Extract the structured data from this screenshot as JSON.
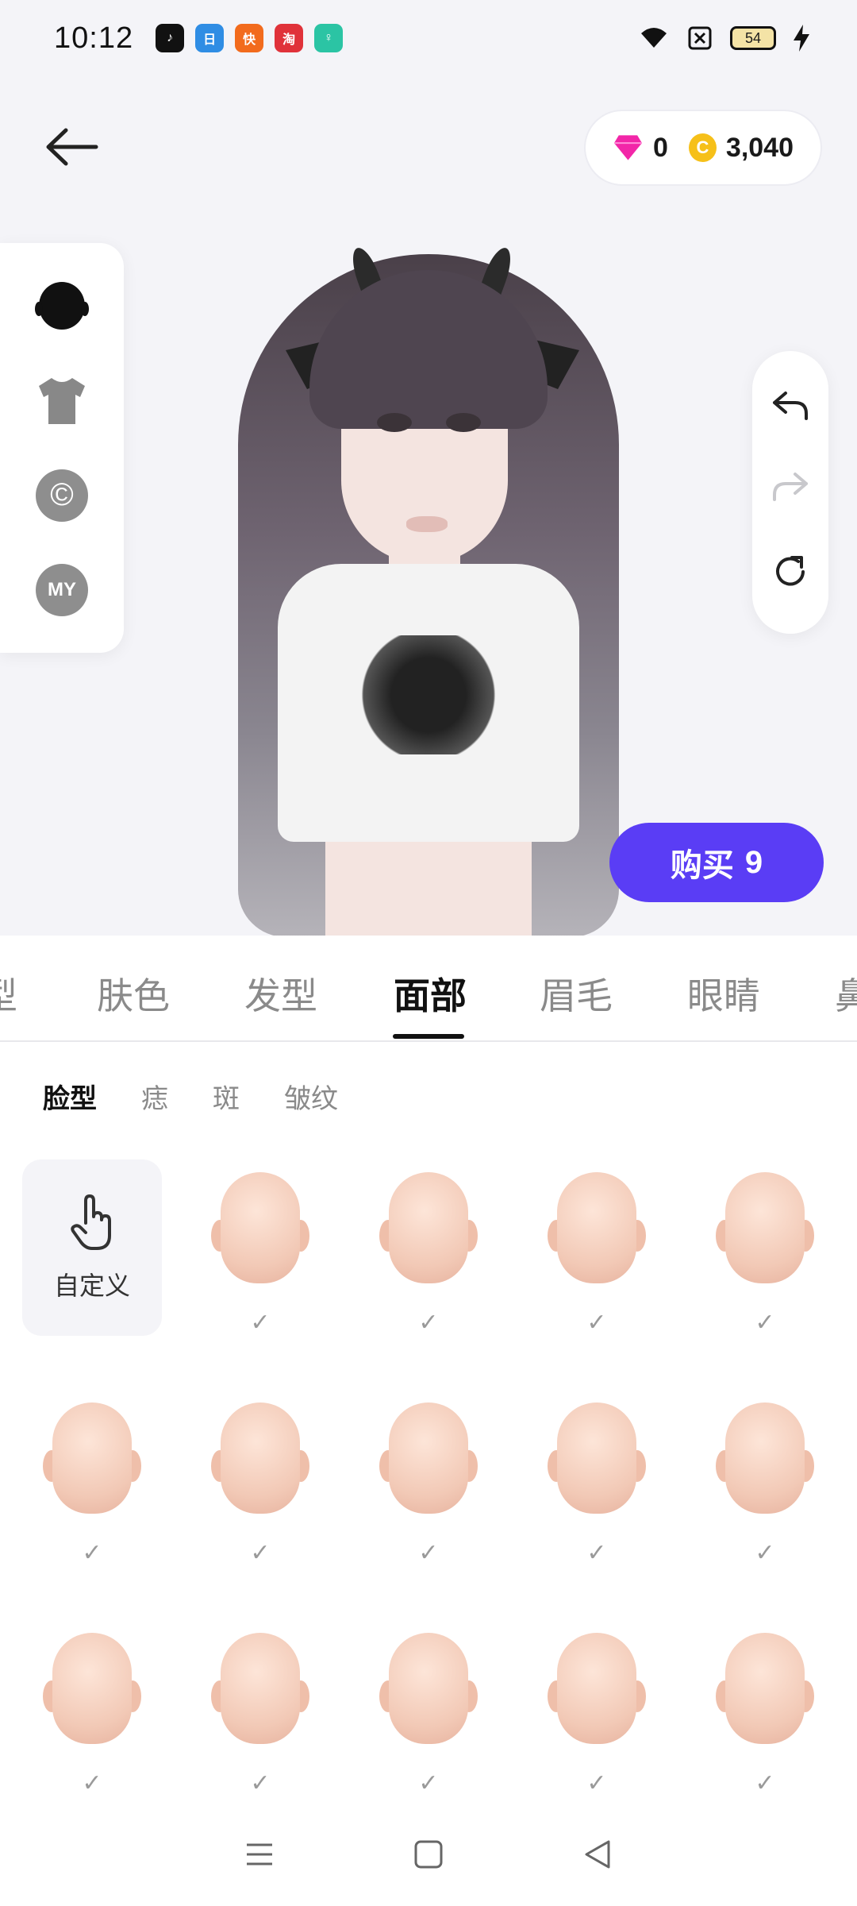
{
  "status_bar": {
    "time": "10:12",
    "battery": "54",
    "apps": [
      {
        "icon": "tiktok-icon",
        "color": "#111111",
        "glyph": "♪"
      },
      {
        "icon": "calendar-app-icon",
        "color": "#2f8de4",
        "glyph": "日"
      },
      {
        "icon": "kuaishou-icon",
        "color": "#f26b1d",
        "glyph": "快"
      },
      {
        "icon": "shopping-app-icon",
        "color": "#e0323a",
        "glyph": "淘"
      },
      {
        "icon": "green-app-icon",
        "color": "#2bc4a4",
        "glyph": "♀"
      }
    ]
  },
  "header": {
    "gems": "0",
    "coins": "3,040",
    "coin_symbol": "C"
  },
  "side_tools": [
    {
      "icon": "head-icon"
    },
    {
      "icon": "tshirt-icon"
    },
    {
      "icon": "copyright-icon",
      "label": "©"
    },
    {
      "icon": "my-icon",
      "label": "MY"
    }
  ],
  "buy": {
    "label": "购买",
    "count": "9",
    "color": "#5a3df5"
  },
  "category_tabs": {
    "items": [
      "型",
      "肤色",
      "发型",
      "面部",
      "眉毛",
      "眼睛",
      "鼻"
    ],
    "active": "面部"
  },
  "sub_tabs": {
    "items": [
      "脸型",
      "痣",
      "斑",
      "皱纹"
    ],
    "active": "脸型"
  },
  "face_grid": {
    "custom_label": "自定义",
    "check_glyph": "✓",
    "rows": 3,
    "cols": 5
  }
}
